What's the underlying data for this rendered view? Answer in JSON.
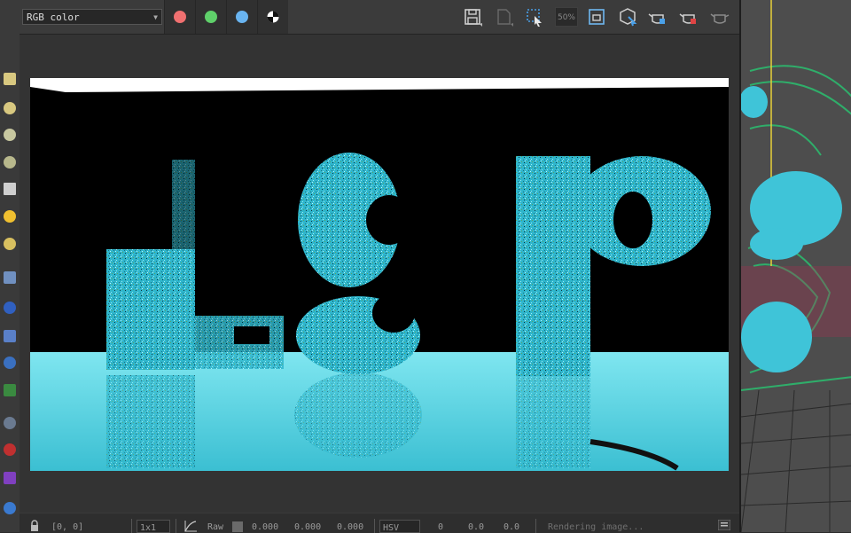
{
  "toolbar": {
    "channel_value": "RGB color",
    "zoom_label": "50%"
  },
  "swatches": [
    {
      "name": "red-channel",
      "color": "#f07070"
    },
    {
      "name": "green-channel",
      "color": "#5fd06a"
    },
    {
      "name": "blue-channel",
      "color": "#69b4f0"
    }
  ],
  "render": {
    "letters": [
      "L",
      "S",
      "P"
    ]
  },
  "status": {
    "coords": "[0, 0]",
    "scale_value": "1x1",
    "raw_label": "Raw",
    "rgb_r": "0.000",
    "rgb_g": "0.000",
    "rgb_b": "0.000",
    "color_space": "HSV",
    "hsv_h": "0",
    "hsv_s": "0.0",
    "hsv_v": "0.0",
    "status_text": "Rendering image..."
  },
  "colors": {
    "accent_cyan": "#44c8dc",
    "floor_cyan": "#5fd8e6",
    "wire_green": "#2fae6a",
    "guide_yellow": "#e8d23a"
  }
}
